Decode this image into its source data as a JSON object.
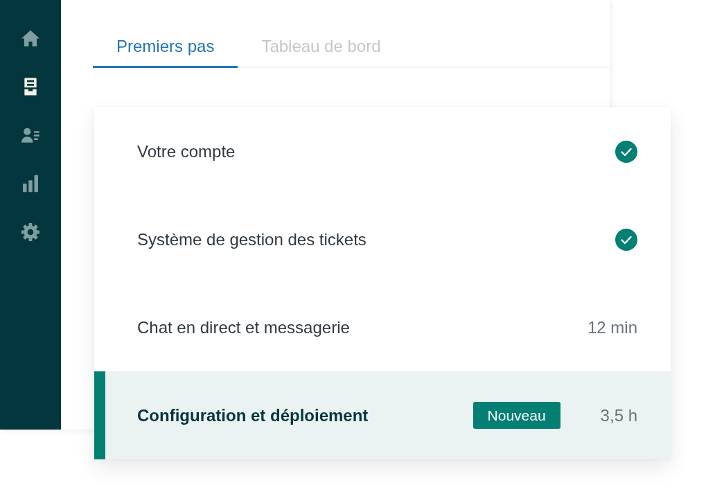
{
  "sidebar": {
    "items": [
      {
        "selected": false
      },
      {
        "selected": true
      },
      {
        "selected": false
      },
      {
        "selected": false
      },
      {
        "selected": false
      }
    ]
  },
  "tabs": [
    {
      "label": "Premiers pas",
      "selected": true
    },
    {
      "label": "Tableau de bord",
      "selected": false
    }
  ],
  "checklist": {
    "items": [
      {
        "title": "Votre compte",
        "completed": true,
        "selected": false
      },
      {
        "title": "Système de gestion des tickets",
        "completed": true,
        "selected": false
      },
      {
        "title": "Chat en direct et messagerie",
        "completed": false,
        "duration": "12 min",
        "selected": false
      },
      {
        "title": "Configuration et déploiement",
        "completed": false,
        "badge": "Nouveau",
        "duration": "3,5 h",
        "selected": true
      }
    ]
  }
}
